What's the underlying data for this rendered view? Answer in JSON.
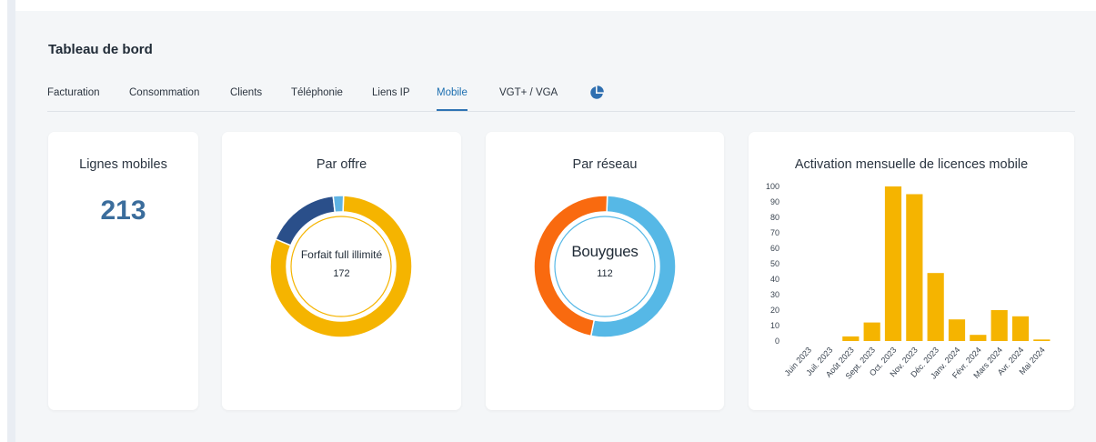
{
  "page": {
    "title": "Tableau de bord"
  },
  "tabs": [
    {
      "label": "Facturation"
    },
    {
      "label": "Consommation"
    },
    {
      "label": "Clients"
    },
    {
      "label": "Téléphonie"
    },
    {
      "label": "Liens IP"
    },
    {
      "label": "Mobile",
      "active": true
    },
    {
      "label": "VGT+ / VGA"
    }
  ],
  "pie_tab_icon": "pie-chart-icon",
  "cards": {
    "lignes": {
      "title": "Lignes mobiles",
      "value": "213"
    },
    "offre": {
      "title": "Par offre",
      "center_label": "Forfait full illimité",
      "center_value": "172",
      "segments": [
        {
          "value": 172,
          "color": "#f5b400"
        },
        {
          "value": 36,
          "color": "#2a4f8a"
        },
        {
          "value": 5,
          "color": "#5fb3e3"
        }
      ]
    },
    "reseau": {
      "title": "Par réseau",
      "center_label": "Bouygues",
      "center_value": "112",
      "segments": [
        {
          "value": 112,
          "color": "#56b8e6"
        },
        {
          "value": 101,
          "color": "#f96a0f"
        }
      ]
    }
  },
  "chart_data": {
    "type": "bar",
    "title": "Activation mensuelle de licences mobile",
    "categories": [
      "Juin 2023",
      "Juil. 2023",
      "Août 2023",
      "Sept. 2023",
      "Oct. 2023",
      "Nov. 2023",
      "Déc. 2023",
      "Janv. 2024",
      "Févr. 2024",
      "Mars 2024",
      "Avr. 2024",
      "Mai 2024"
    ],
    "values": [
      0,
      0,
      3,
      12,
      100,
      95,
      44,
      14,
      4,
      20,
      16,
      1
    ],
    "yticks": [
      0,
      10,
      20,
      30,
      40,
      50,
      60,
      70,
      80,
      90,
      100
    ],
    "ylim": [
      0,
      100
    ],
    "color": "#f5b400",
    "grid": false
  }
}
